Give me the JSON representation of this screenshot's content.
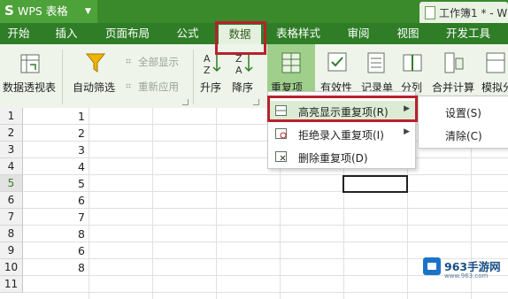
{
  "app": {
    "logo_letter": "S",
    "name": "WPS 表格",
    "document_title": "工作簿1 * - W"
  },
  "menu": [
    "开始",
    "插入",
    "页面布局",
    "公式",
    "数据",
    "表格样式",
    "审阅",
    "视图",
    "开发工具"
  ],
  "ribbon": {
    "pivot": "数据透视表",
    "autofilter": "自动筛选",
    "show_all": "全部显示",
    "reapply": "重新应用",
    "sort_asc": "升序",
    "sort_desc": "降序",
    "duplicates": "重复项",
    "validity": "有效性",
    "record_form": "记录单",
    "outline": "分列",
    "consolidate": "合并计算",
    "what_if": "模拟分"
  },
  "dropdown": {
    "items": [
      "高亮显示重复项(R)",
      "拒绝录入重复项(I)",
      "删除重复项(D)"
    ],
    "submenu": [
      "设置(S)",
      "清除(C)"
    ]
  },
  "rows": [
    "1",
    "2",
    "3",
    "4",
    "5",
    "6",
    "7",
    "8",
    "9",
    "10",
    "11"
  ],
  "column_b_values": [
    "1",
    "2",
    "3",
    "4",
    "5",
    "6",
    "7",
    "8",
    "6",
    "8"
  ],
  "watermark": {
    "name": "963手游网",
    "url": "www.963.com"
  },
  "colors": {
    "title_green": "#3a8a2c",
    "menu_green": "#2f7d27",
    "highlight_red": "#b8222b"
  }
}
